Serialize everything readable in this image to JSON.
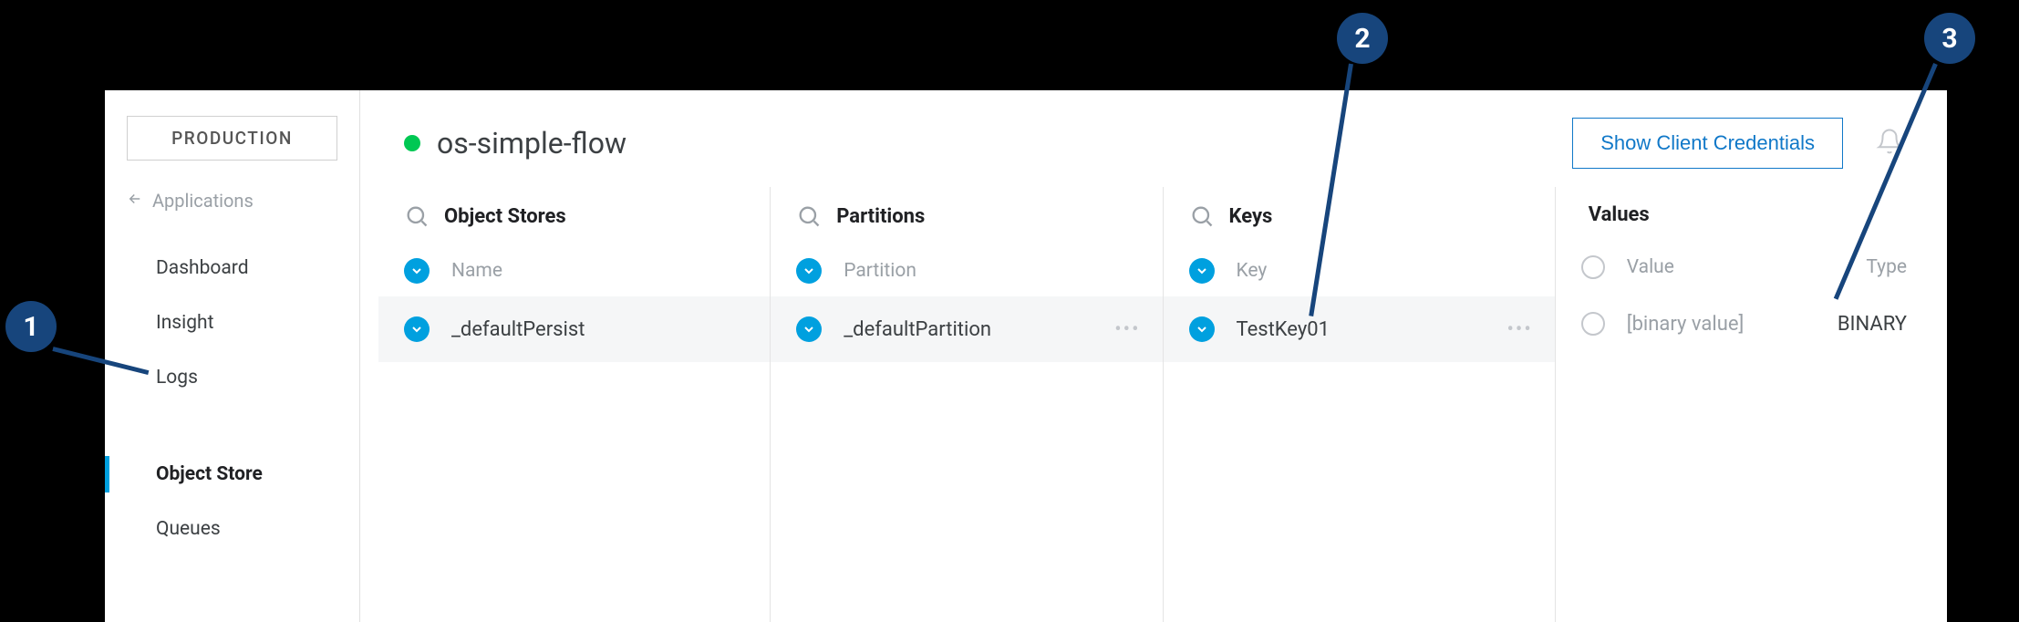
{
  "sidebar": {
    "env_label": "PRODUCTION",
    "back_label": "Applications",
    "items": [
      "Dashboard",
      "Insight",
      "Logs",
      "Object Store",
      "Queues"
    ],
    "active_index": 3
  },
  "header": {
    "title": "os-simple-flow",
    "credentials_button": "Show Client Credentials"
  },
  "columns": {
    "object_stores": {
      "title": "Object Stores",
      "subhead": "Name",
      "row": "_defaultPersist"
    },
    "partitions": {
      "title": "Partitions",
      "subhead": "Partition",
      "row": "_defaultPartition"
    },
    "keys": {
      "title": "Keys",
      "subhead": "Key",
      "row": "TestKey01"
    },
    "values": {
      "title": "Values",
      "subhead_value": "Value",
      "subhead_type": "Type",
      "row_value": "[binary value]",
      "row_type": "BINARY"
    }
  },
  "callouts": [
    "1",
    "2",
    "3"
  ]
}
